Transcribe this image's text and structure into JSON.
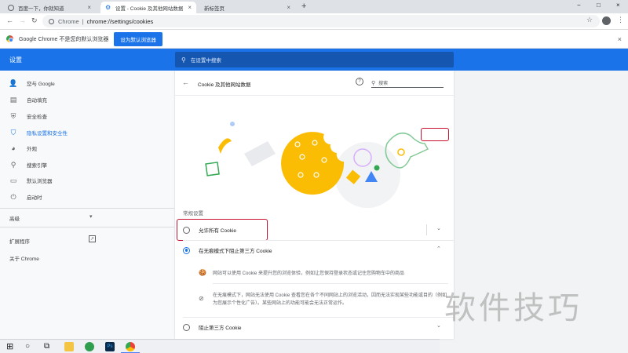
{
  "tabs": [
    {
      "label": "百度一下，你就知道",
      "close": "×"
    },
    {
      "label": "设置 - Cookie 及其他网站数据",
      "close": "×"
    },
    {
      "label": "新标签页",
      "close": "×"
    }
  ],
  "new_tab": "+",
  "window_controls": {
    "minimize": "−",
    "maximize": "□",
    "close": "×"
  },
  "toolbar": {
    "back": "←",
    "forward": "→",
    "reload": "↻",
    "host": "Chrome",
    "separator": "|",
    "url": "chrome://settings/cookies",
    "bookmark_star": "☆",
    "menu": "⋮"
  },
  "infobar": {
    "message": "Google Chrome 不是您的默认浏览器",
    "button": "设为默认浏览器",
    "close": "×"
  },
  "header": {
    "title": "设置",
    "search_placeholder": "在设置中搜索"
  },
  "sidebar": {
    "items": [
      {
        "label": "您与 Google",
        "icon": "👤"
      },
      {
        "label": "自动填充",
        "icon": "▤"
      },
      {
        "label": "安全检查",
        "icon": "⛨"
      },
      {
        "label": "隐私设置和安全性",
        "icon": "⛉"
      },
      {
        "label": "外观",
        "icon": "◕"
      },
      {
        "label": "搜索引擎",
        "icon": "⚲"
      },
      {
        "label": "默认浏览器",
        "icon": "▭"
      },
      {
        "label": "启动时",
        "icon": "⏻"
      }
    ],
    "advanced": "高级",
    "advanced_arrow": "▾",
    "extensions": "扩展程序",
    "extensions_icon": "↗",
    "about": "关于 Chrome"
  },
  "panel": {
    "back": "←",
    "title": "Cookie 及其他网站数据",
    "help": "?",
    "search_placeholder": "搜索",
    "section_label": "常规设置",
    "options": [
      {
        "label": "允许所有 Cookie",
        "checked": false,
        "chevron": "⌄"
      },
      {
        "label": "在无痕模式下阻止第三方 Cookie",
        "checked": true,
        "chevron": "⌃"
      },
      {
        "label": "阻止第三方 Cookie",
        "checked": false,
        "chevron": "⌄"
      }
    ],
    "details": [
      {
        "icon": "🍪",
        "text": "网站可以使用 Cookie 来提升您的浏览体验，例如让您保持登录状态或记住您购物车中的商品"
      },
      {
        "icon": "⊘",
        "text": "在无痕模式下，网站无法使用 Cookie 查看您在各个不同网站上的浏览活动，因而无法实现某些功能或目的（例如为您展示个性化广告）。某些网站上的功能可能会无法正常运作。"
      }
    ]
  },
  "taskbar": {
    "start": "⊞",
    "search": "○",
    "taskview": "⧉"
  },
  "watermark": "软件技巧",
  "colors": {
    "accent": "#1a73e8",
    "highlight": "#c8102e",
    "cookie": "#fbbc04"
  }
}
